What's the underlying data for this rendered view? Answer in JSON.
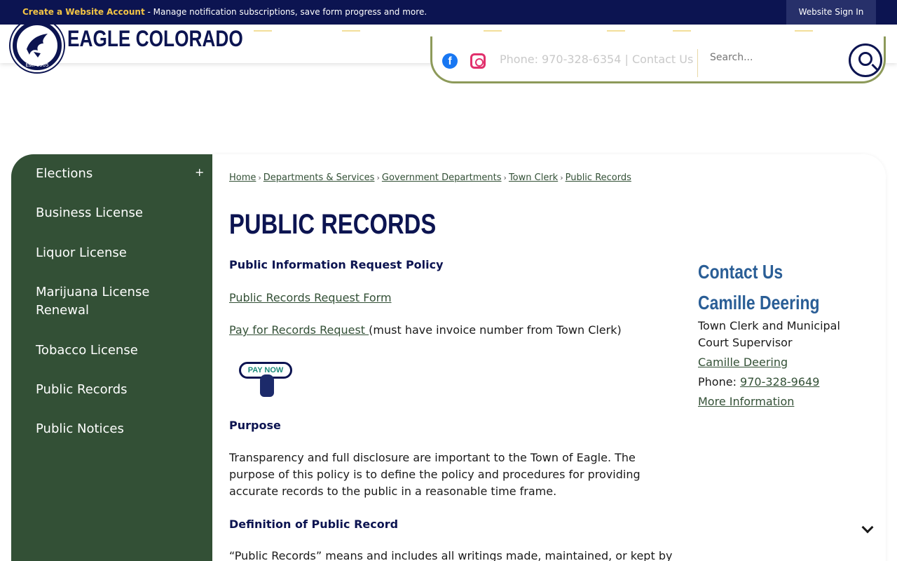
{
  "topbar": {
    "create_account": "Create a Website Account",
    "message": " - Manage notification subscriptions, save form progress and more.",
    "sign_in": "Website Sign In"
  },
  "header": {
    "logo_text": "EAGLE COLORADO",
    "seal_text": "Est. 1905"
  },
  "utility": {
    "phone_text": "Phone: 970-328-6354 | Contact Us",
    "search_placeholder": "Search..."
  },
  "sidebar": {
    "items": [
      {
        "label": "Elections"
      },
      {
        "label": "Business License"
      },
      {
        "label": "Liquor License"
      },
      {
        "label": "Marijuana License Renewal"
      },
      {
        "label": "Tobacco License"
      },
      {
        "label": "Public Records"
      },
      {
        "label": "Public Notices"
      }
    ],
    "toggle": "+"
  },
  "breadcrumb": [
    "Home",
    "Departments & Services",
    "Government Departments",
    "Town Clerk",
    "Public Records"
  ],
  "breadcrumb_separator": "›",
  "page_title": "PUBLIC RECORDS",
  "content": {
    "policy_heading": "Public Information Request Policy",
    "request_form_link": "Public Records Request Form",
    "pay_link": "Pay for Records Request ",
    "pay_note": "(must have invoice number from Town Clerk)",
    "pay_now_button": "PAY NOW",
    "purpose_heading": "Purpose",
    "purpose_text": "Transparency and full disclosure are important to the Town of Eagle. The purpose of this policy is to define the policy and procedures for providing accurate records to the public in a reasonable time frame.",
    "definition_heading": "Definition of Public Record",
    "definition_text": "“Public Records” means and includes all writings made, maintained, or kept by"
  },
  "contact": {
    "heading": "Contact Us",
    "name_heading": "Camille Deering",
    "role": "Town Clerk and Municipal Court Supervisor",
    "email_link": "Camille Deering",
    "phone_label": "Phone: ",
    "phone_link": "970-328-9649",
    "more_link": "More Information"
  },
  "colors": {
    "navy": "#0c1451",
    "sidebar_green": "#335036",
    "contact_blue": "#2a5e96",
    "accent_gold": "#f3c445"
  }
}
